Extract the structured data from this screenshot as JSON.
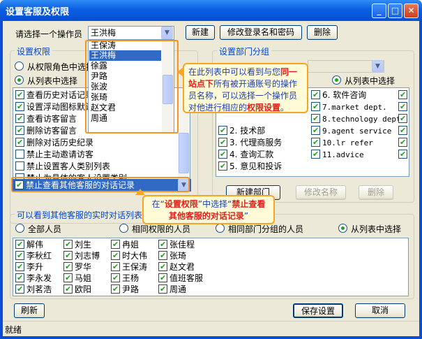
{
  "window": {
    "title": "设置客服及权限",
    "minimize": "_",
    "maximize": "□",
    "close": "✕"
  },
  "operator": {
    "label": "请选择一个操作员",
    "selected": "王洪梅",
    "new_btn": "新建",
    "edit_btn": "修改登录名和密码",
    "delete_btn": "删除",
    "dropdown_items": [
      "王保涛",
      "王洪梅",
      "徐露",
      "尹路",
      "张波",
      "张琦",
      "赵文君",
      "周通"
    ]
  },
  "permissions": {
    "title": "设置权限",
    "radio_role": "从权限角色中选择",
    "radio_list": "从列表中选择",
    "items": [
      {
        "label": "查看历史对话记录",
        "checked": true
      },
      {
        "label": "设置浮动图标默认",
        "checked": true
      },
      {
        "label": "查看访客留言",
        "checked": true
      },
      {
        "label": "删除访客留言",
        "checked": true
      },
      {
        "label": "删除对话历史纪录",
        "checked": true
      },
      {
        "label": "禁止主动邀请访客",
        "checked": false
      },
      {
        "label": "禁止设置客人类别列表",
        "checked": false
      },
      {
        "label": "禁止为具体的客人设置类别",
        "checked": false
      },
      {
        "label": "禁止查看其他客服的对话记录",
        "checked": true
      }
    ]
  },
  "departments": {
    "title": "设置部门分组",
    "radio_list": "从列表中选择",
    "col1": [
      {
        "label": "2. 技术部",
        "checked": true
      },
      {
        "label": "3. 代理商服务",
        "checked": true
      },
      {
        "label": "4. 查询汇款",
        "checked": true
      },
      {
        "label": "5. 意见和投诉",
        "checked": true
      }
    ],
    "col2": [
      {
        "label": "6. 软件咨询",
        "checked": true
      },
      {
        "label": "7.market dept.",
        "checked": true
      },
      {
        "label": "8.technology dept.",
        "checked": true
      },
      {
        "label": "9.agent service",
        "checked": true
      },
      {
        "label": "10.lr refer",
        "checked": true
      },
      {
        "label": "11.advice",
        "checked": true
      }
    ],
    "new_btn": "新建部门",
    "rename_btn": "修改名称",
    "delete_btn": "删除"
  },
  "tooltips": {
    "t1_pre": "在此列表中可以看到与您",
    "t1_hl1": "同一站点下",
    "t1_mid": "所有被开通账号的操作员名称，可以选择一个操作员对他进行相应的",
    "t1_hl2": "权限设置",
    "t1_post": "。",
    "t2_pre": "在“",
    "t2_hl1": "设置权限",
    "t2_mid": "”中选择“",
    "t2_hl2": "禁止查看其他客服的对话记录",
    "t2_post": "”"
  },
  "realtime": {
    "title": "可以看到其他客服的实时对话列表",
    "radio_all": "全部人员",
    "radio_same_perm": "相同权限的人员",
    "radio_same_group": "相同部门分组的人员",
    "radio_list": "从列表中选择",
    "people": [
      [
        "解伟",
        "刘生",
        "冉姐",
        "张佳程"
      ],
      [
        "李秋红",
        "刘志博",
        "时大伟",
        "张琦"
      ],
      [
        "李升",
        "罗华",
        "王保涛",
        "赵文君"
      ],
      [
        "李永发",
        "马姐",
        "王杨",
        "值班客服"
      ],
      [
        "刘茗浩",
        "欧阳",
        "尹路",
        "周通"
      ]
    ]
  },
  "footer": {
    "refresh_btn": "刷新",
    "save_btn": "保存设置",
    "cancel_btn": "取消",
    "status": "就绪"
  }
}
